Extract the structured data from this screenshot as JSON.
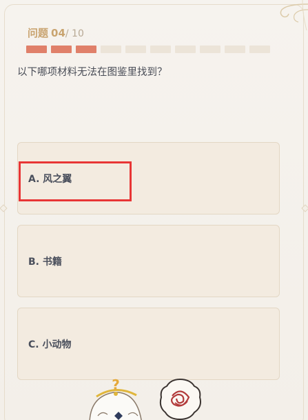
{
  "quiz": {
    "question_label": "问题",
    "question_number": "04",
    "question_total": "/ 10",
    "progress": {
      "completed": 3,
      "total": 10
    },
    "question_text": "以下哪项材料无法在图鉴里找到？",
    "options": [
      {
        "label": "A. 风之翼"
      },
      {
        "label": "B. 书籍"
      },
      {
        "label": "C. 小动物"
      }
    ]
  },
  "colors": {
    "accent_progress": "#e0806a",
    "header_gold": "#c9a470",
    "highlight_red": "#e83535"
  },
  "icons": {
    "mascot": "paimon-mascot-icon",
    "sticker": "rose-sticker-icon",
    "corner": "ornament-corner-icon"
  }
}
